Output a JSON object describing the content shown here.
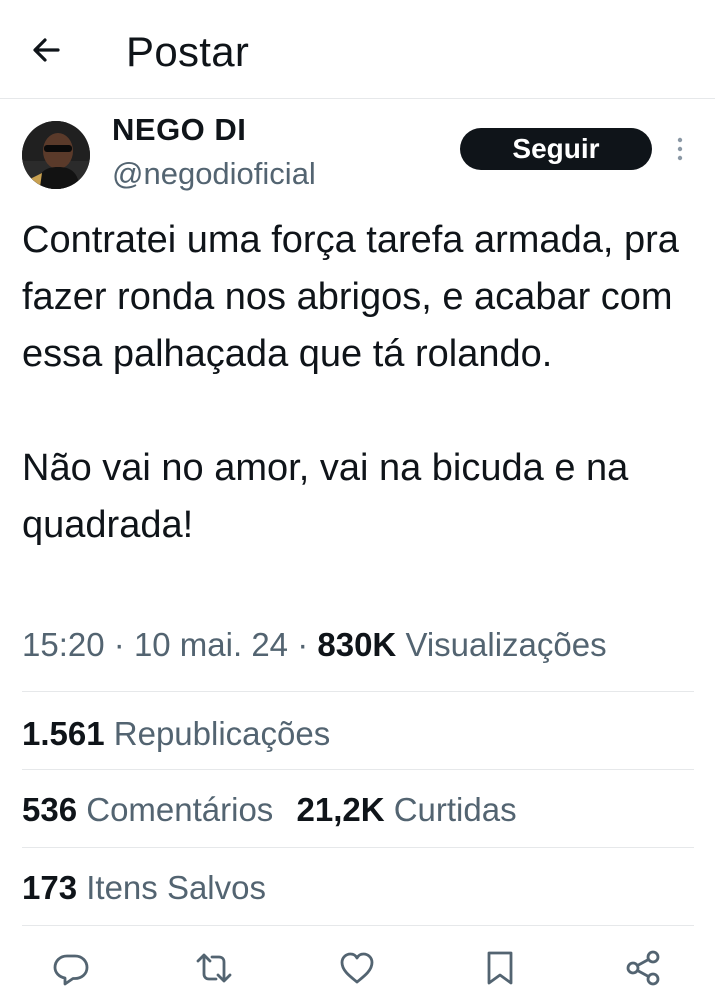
{
  "header": {
    "title": "Postar",
    "back_icon": "arrow-left-icon"
  },
  "author": {
    "name": "NEGO DI",
    "handle": "@negodioficial",
    "follow_label": "Seguir"
  },
  "tweet": {
    "paragraphs": [
      "Contratei uma força tarefa armada, pra fazer ronda nos abrigos, e acabar com essa palhaçada que tá rolando.",
      "Não vai no amor, vai na bicuda e na quadrada!"
    ]
  },
  "meta": {
    "time": "15:20",
    "separator": "·",
    "date": "10 mai. 24",
    "views_count": "830K",
    "views_label": "Visualizações"
  },
  "stats": {
    "reposts": {
      "count": "1.561",
      "label": "Republicações"
    },
    "comments": {
      "count": "536",
      "label": "Comentários"
    },
    "likes": {
      "count": "21,2K",
      "label": "Curtidas"
    },
    "bookmarks": {
      "count": "173",
      "label": "Itens Salvos"
    }
  },
  "actions": [
    "reply-icon",
    "repost-icon",
    "like-icon",
    "bookmark-icon",
    "share-icon"
  ],
  "colors": {
    "text": "#0f1419",
    "secondary": "#536471",
    "divider": "#e6e8ea",
    "button_bg": "#0f1419"
  }
}
